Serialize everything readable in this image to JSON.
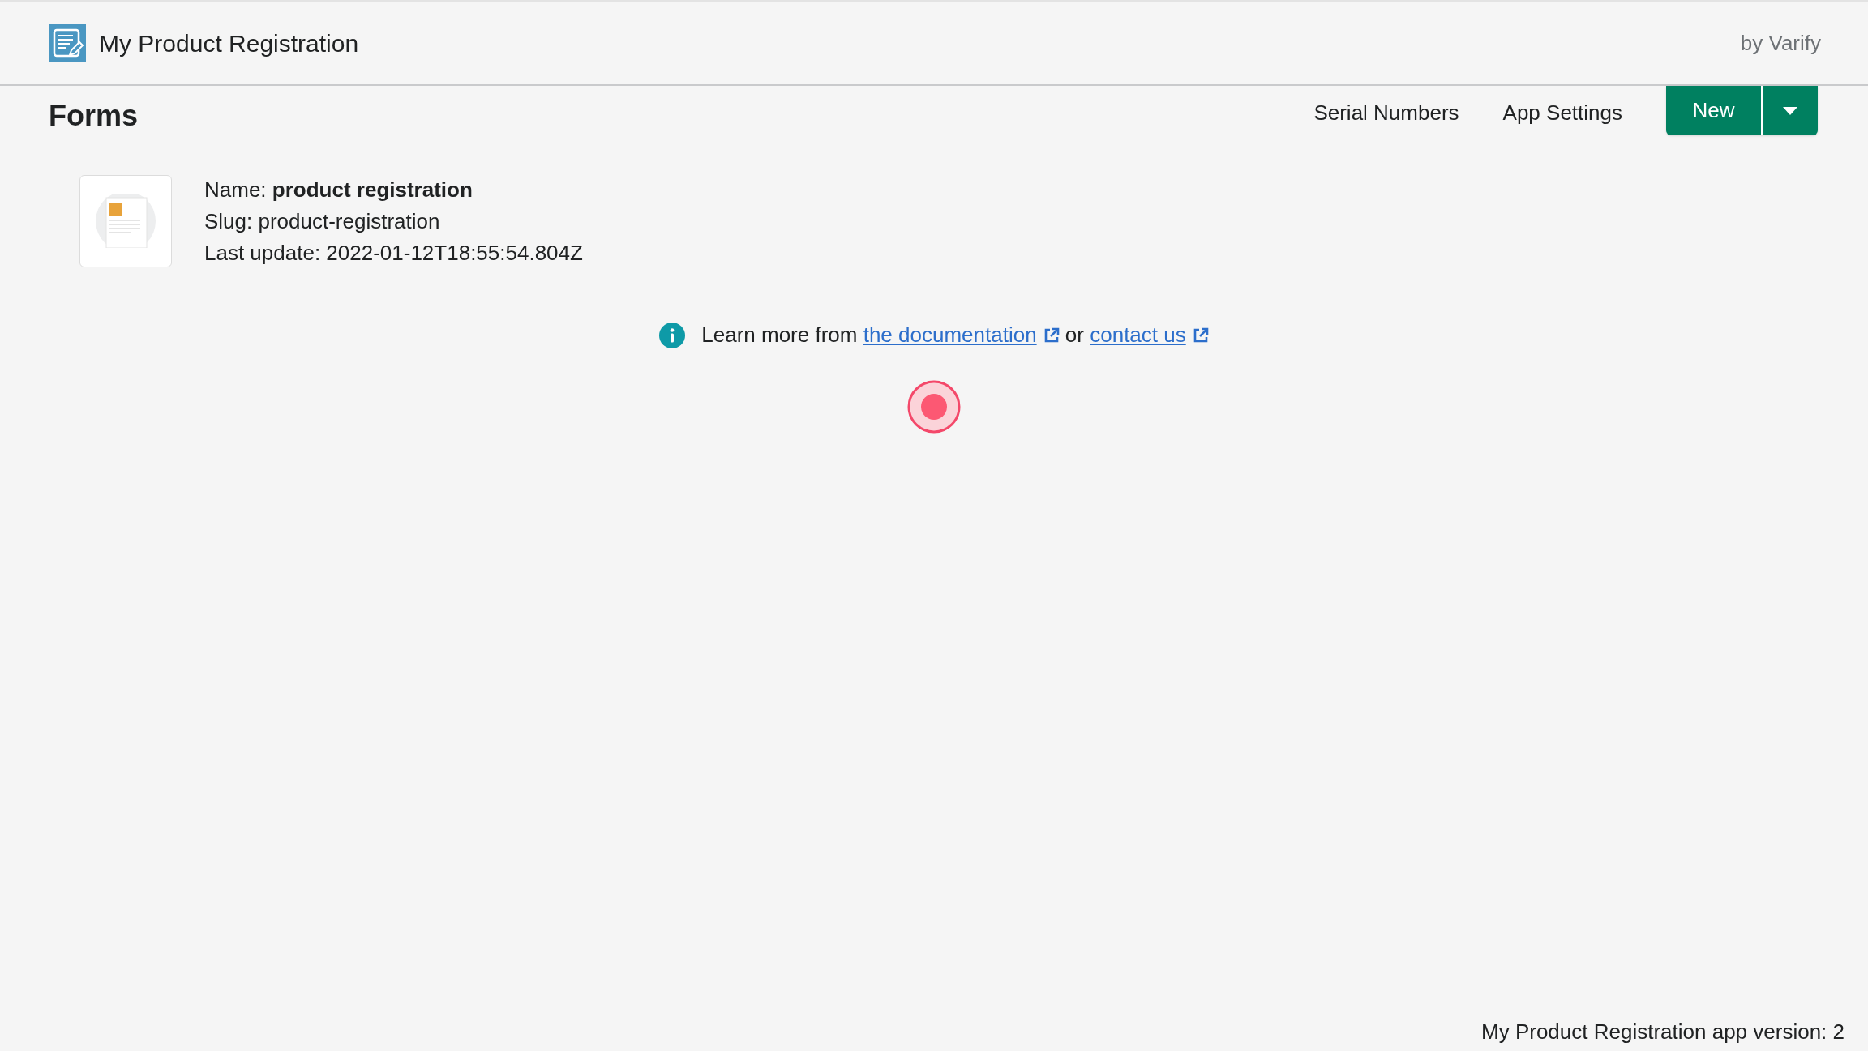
{
  "app_header": {
    "title": "My Product Registration",
    "byline": "by Varify"
  },
  "page": {
    "title": "Forms",
    "nav_links": [
      "Serial Numbers",
      "App Settings"
    ],
    "new_button": {
      "label": "New"
    }
  },
  "forms": [
    {
      "name": "Name: **product registration**",
      "slug": "Slug: product-registration",
      "last_update": "Last update: 2022-01-12T18:55:54.804Z"
    }
  ],
  "help": {
    "parts": [
      {
        "kind": "text",
        "text": "Learn more from"
      },
      {
        "kind": "link",
        "text": "the documentation"
      },
      {
        "kind": "text",
        "text": "or"
      },
      {
        "kind": "link",
        "text": "contact us"
      }
    ]
  },
  "footer": "My Product Registration app version: 2"
}
